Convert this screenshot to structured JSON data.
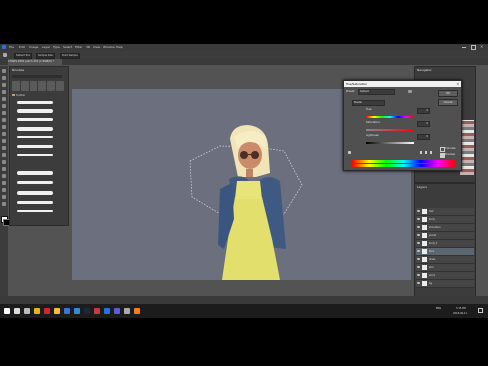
{
  "app": {
    "menu": [
      "File",
      "Edit",
      "Image",
      "Layer",
      "Type",
      "Select",
      "Filter",
      "3D",
      "View",
      "Window",
      "Help"
    ],
    "options": [
      "Default Tool",
      "Sample Size:",
      "Point Sample"
    ],
    "doc_tab": "CHARS 2081 patch 301 (1 RGB/8) *"
  },
  "brushes": {
    "panel_title": "Brushes",
    "folder": "Scatter"
  },
  "navigator": {
    "title": "Navigator"
  },
  "layers": {
    "title": "Layers",
    "rows": [
      {
        "name": "hair"
      },
      {
        "name": "body"
      },
      {
        "name": "shoulders"
      },
      {
        "name": "jacket"
      },
      {
        "name": "body 2"
      },
      {
        "name": "face"
      },
      {
        "name": "dress"
      },
      {
        "name": "skin"
      },
      {
        "name": "arms"
      },
      {
        "name": "bg"
      }
    ],
    "selected_index": 5
  },
  "dialog": {
    "title": "Hue/Saturation",
    "close": "✕",
    "preset_label": "Preset:",
    "preset_value": "Default",
    "channel_value": "Master",
    "hue_label": "Hue:",
    "hue_value": "0",
    "saturation_label": "Saturation:",
    "saturation_value": "0",
    "lightness_label": "Lightness:",
    "lightness_value": "0",
    "ok": "OK",
    "cancel": "Cancel",
    "colorize_label": "Colorize",
    "preview_label": "Preview",
    "colorize_checked": false,
    "preview_checked": true,
    "accent": "#3d7bc6"
  },
  "taskbar": {
    "time": "3:15 PM",
    "date": "2018-06-11",
    "lang": "ENG",
    "icons": [
      "start-icon",
      "search-icon",
      "task-view-icon",
      "chrome-icon",
      "opera-icon",
      "file-explorer-icon",
      "mail-icon",
      "photos-icon",
      "steam-icon",
      "media-icon",
      "photoshop-icon",
      "store-icon",
      "settings-icon",
      "firefox-icon"
    ]
  }
}
